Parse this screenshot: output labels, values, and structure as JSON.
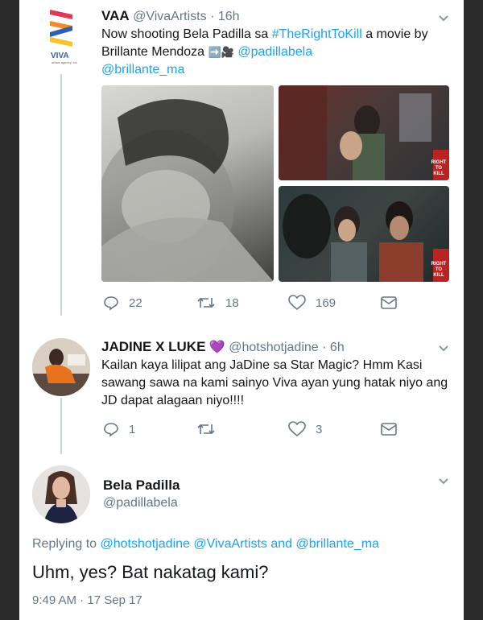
{
  "tweet1": {
    "display_name": "VAA",
    "handle": "@VivaArtists",
    "time": "· 16h",
    "text_pre": "Now shooting Bela Padilla  sa ",
    "hashtag": "#TheRightToKill",
    "text_mid": " a movie by Brillante Mendoza ",
    "emoji": "➡️🎥",
    "mention1": "@padillabela",
    "mention2": "@brillante_ma",
    "logo_text": "VIVA",
    "logo_subtext": "artists agency, inc",
    "poster_text": "RIGHT TO KILL",
    "replies": "22",
    "retweets": "18",
    "likes": "169"
  },
  "tweet2": {
    "display_name": "JADINE X LUKE",
    "heart": "💜",
    "handle": "@hotshotjadine",
    "time": "· 6h",
    "text": "Kailan kaya lilipat ang JaDine sa Star Magic? Hmm Kasi sawang sawa na kami sainyo Viva ayan yung hatak niyo ang JD dapat alagaan niyo!!!!",
    "replies": "1",
    "likes": "3"
  },
  "tweet3": {
    "display_name": "Bela Padilla",
    "handle": "@padillabela",
    "replying_prefix": "Replying to ",
    "reply_to_1": "@hotshotjadine",
    "reply_to_2": "@VivaArtists",
    "reply_and": " and ",
    "reply_to_3": "@brillante_ma",
    "text": "Uhm, yes? Bat nakatag kami?",
    "timestamp": "9:49 AM · 17 Sep 17"
  },
  "colors": {
    "accent": "#1da1f2",
    "text": "#14171a",
    "muted": "#657786",
    "thread": "#ccd6dd"
  }
}
